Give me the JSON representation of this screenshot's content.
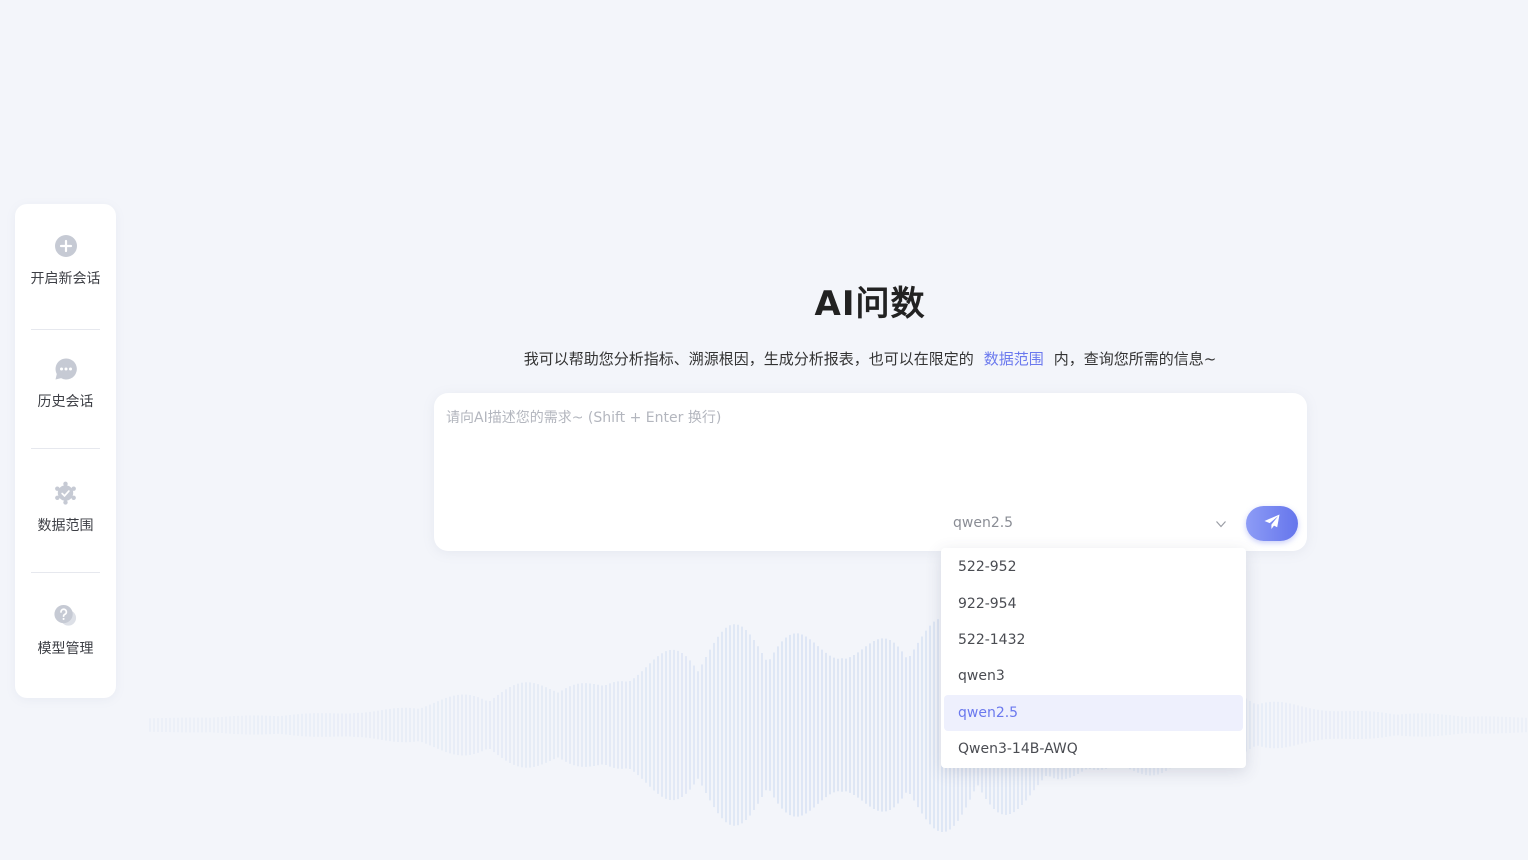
{
  "sidebar": {
    "items": [
      {
        "label": "开启新会话",
        "icon": "plus-circle-icon"
      },
      {
        "label": "历史会话",
        "icon": "chat-bubble-icon"
      },
      {
        "label": "数据范围",
        "icon": "data-scope-icon"
      },
      {
        "label": "模型管理",
        "icon": "question-chat-icon"
      }
    ]
  },
  "main": {
    "title": "AI问数",
    "subtitle_prefix": "我可以帮助您分析指标、溯源根因，生成分析报表，也可以在限定的",
    "subtitle_link": "数据范围",
    "subtitle_suffix": "内，查询您所需的信息~"
  },
  "input": {
    "placeholder": "请向AI描述您的需求~ (Shift + Enter 换行)",
    "value": ""
  },
  "model_select": {
    "selected": "qwen2.5",
    "options": [
      "522-952",
      "922-954",
      "522-1432",
      "qwen3",
      "qwen2.5",
      "Qwen3-14B-AWQ"
    ]
  },
  "colors": {
    "accent": "#6b79ee",
    "background": "#f3f5fa",
    "icon_gray": "#c6cad4"
  }
}
